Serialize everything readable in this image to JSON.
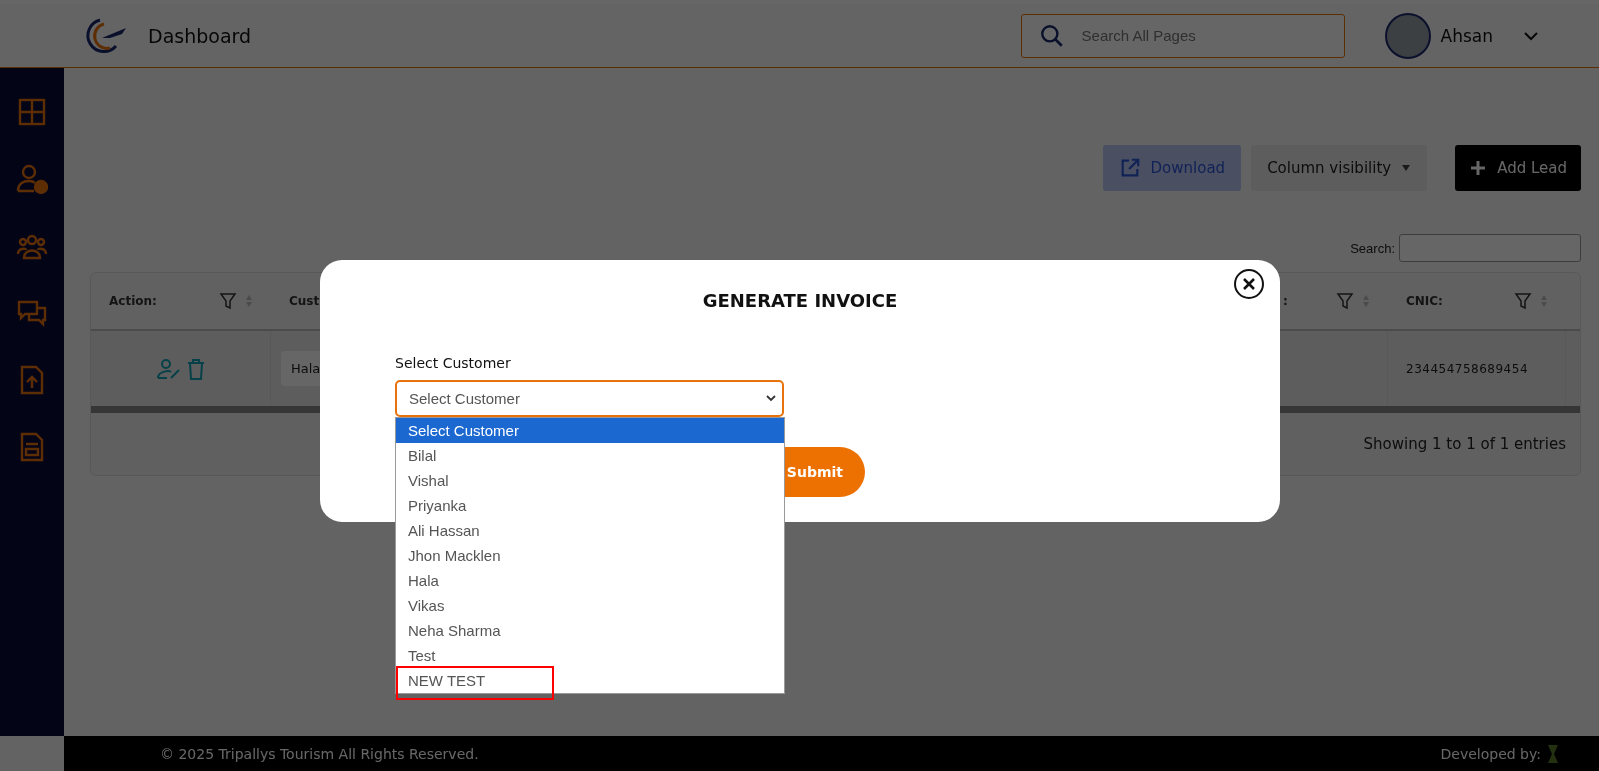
{
  "header": {
    "title": "Dashboard",
    "search": {
      "placeholder": "Search All Pages"
    },
    "user": {
      "name": "Ahsan"
    }
  },
  "toolbar": {
    "buttons": [
      {
        "kind": "download",
        "label": "Download"
      },
      {
        "kind": "columns",
        "label": "Column visibility"
      },
      {
        "kind": "add",
        "label": "Add Lead"
      }
    ]
  },
  "table": {
    "search_label": "Search:",
    "columns": [
      "Action:",
      "Cust",
      ":",
      "CNIC:"
    ],
    "rows": [
      {
        "customer": "Hala",
        "cnic": "234454758689454"
      }
    ],
    "info": "Showing 1 to 1 of 1 entries"
  },
  "modal": {
    "title": "GENERATE INVOICE",
    "field_label": "Select Customer",
    "select_value": "Select Customer",
    "submit": "Submit",
    "options": [
      {
        "label": "Select Customer",
        "selected": true,
        "highlighted": false
      },
      {
        "label": "Bilal",
        "selected": false,
        "highlighted": false
      },
      {
        "label": "Vishal",
        "selected": false,
        "highlighted": false
      },
      {
        "label": "Priyanka",
        "selected": false,
        "highlighted": false
      },
      {
        "label": "Ali Hassan",
        "selected": false,
        "highlighted": false
      },
      {
        "label": "Jhon Macklen",
        "selected": false,
        "highlighted": false
      },
      {
        "label": "Hala",
        "selected": false,
        "highlighted": false
      },
      {
        "label": "Vikas",
        "selected": false,
        "highlighted": false
      },
      {
        "label": "Neha Sharma",
        "selected": false,
        "highlighted": false
      },
      {
        "label": "Test",
        "selected": false,
        "highlighted": false
      },
      {
        "label": "NEW TEST",
        "selected": false,
        "highlighted": true
      }
    ]
  },
  "footer": {
    "copyright": "© 2025 Tripallys Tourism All Rights Reserved.",
    "credit": "Developed by:"
  }
}
